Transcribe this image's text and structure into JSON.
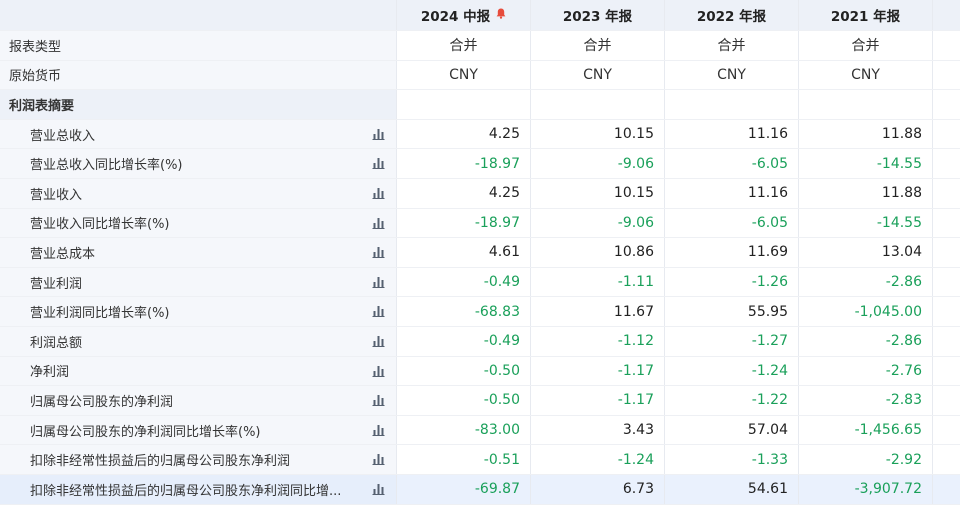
{
  "header": {
    "columns": [
      "2024 中报",
      "2023 年报",
      "2022 年报",
      "2021 年报"
    ]
  },
  "meta_rows": [
    {
      "label": "报表类型",
      "values": [
        "合并",
        "合并",
        "合并",
        "合并"
      ]
    },
    {
      "label": "原始货币",
      "values": [
        "CNY",
        "CNY",
        "CNY",
        "CNY"
      ]
    }
  ],
  "section_title": "利润表摘要",
  "rows": [
    {
      "label": "营业总收入",
      "values": [
        "4.25",
        "10.15",
        "11.16",
        "11.88"
      ],
      "signs": [
        "pos",
        "pos",
        "pos",
        "pos"
      ]
    },
    {
      "label": "营业总收入同比增长率(%)",
      "values": [
        "-18.97",
        "-9.06",
        "-6.05",
        "-14.55"
      ],
      "signs": [
        "neg",
        "neg",
        "neg",
        "neg"
      ]
    },
    {
      "label": "营业收入",
      "values": [
        "4.25",
        "10.15",
        "11.16",
        "11.88"
      ],
      "signs": [
        "pos",
        "pos",
        "pos",
        "pos"
      ]
    },
    {
      "label": "营业收入同比增长率(%)",
      "values": [
        "-18.97",
        "-9.06",
        "-6.05",
        "-14.55"
      ],
      "signs": [
        "neg",
        "neg",
        "neg",
        "neg"
      ]
    },
    {
      "label": "营业总成本",
      "values": [
        "4.61",
        "10.86",
        "11.69",
        "13.04"
      ],
      "signs": [
        "pos",
        "pos",
        "pos",
        "pos"
      ]
    },
    {
      "label": "营业利润",
      "values": [
        "-0.49",
        "-1.11",
        "-1.26",
        "-2.86"
      ],
      "signs": [
        "neg",
        "neg",
        "neg",
        "neg"
      ]
    },
    {
      "label": "营业利润同比增长率(%)",
      "values": [
        "-68.83",
        "11.67",
        "55.95",
        "-1,045.00"
      ],
      "signs": [
        "neg",
        "pos",
        "pos",
        "neg"
      ]
    },
    {
      "label": "利润总额",
      "values": [
        "-0.49",
        "-1.12",
        "-1.27",
        "-2.86"
      ],
      "signs": [
        "neg",
        "neg",
        "neg",
        "neg"
      ]
    },
    {
      "label": "净利润",
      "values": [
        "-0.50",
        "-1.17",
        "-1.24",
        "-2.76"
      ],
      "signs": [
        "neg",
        "neg",
        "neg",
        "neg"
      ]
    },
    {
      "label": "归属母公司股东的净利润",
      "values": [
        "-0.50",
        "-1.17",
        "-1.22",
        "-2.83"
      ],
      "signs": [
        "neg",
        "neg",
        "neg",
        "neg"
      ]
    },
    {
      "label": "归属母公司股东的净利润同比增长率(%)",
      "values": [
        "-83.00",
        "3.43",
        "57.04",
        "-1,456.65"
      ],
      "signs": [
        "neg",
        "pos",
        "pos",
        "neg"
      ]
    },
    {
      "label": "扣除非经常性损益后的归属母公司股东净利润",
      "values": [
        "-0.51",
        "-1.24",
        "-1.33",
        "-2.92"
      ],
      "signs": [
        "neg",
        "neg",
        "neg",
        "neg"
      ]
    },
    {
      "label": "扣除非经常性损益后的归属母公司股东净利润同比增...",
      "values": [
        "-69.87",
        "6.73",
        "54.61",
        "-3,907.72"
      ],
      "signs": [
        "neg",
        "pos",
        "pos",
        "neg"
      ]
    }
  ],
  "colors": {
    "positive": "#222222",
    "negative": "#1aa05a",
    "bell": "#e74c3c",
    "highlight_row": "#eaf1fd"
  },
  "icons": {
    "row_chart": "bar-chart-icon",
    "header_alert": "bell-icon"
  }
}
